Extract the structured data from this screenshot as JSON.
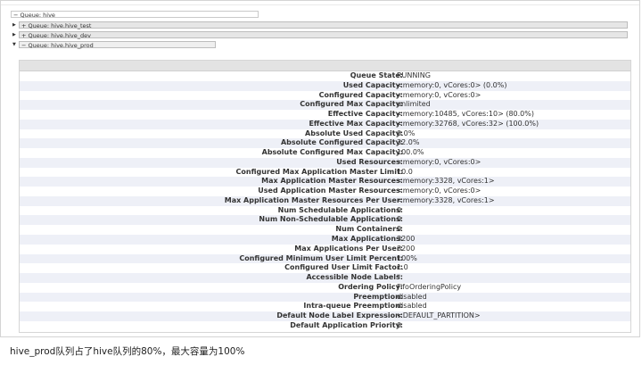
{
  "queues": {
    "root": "Queue: hive",
    "children": [
      {
        "label": "Queue: hive.hive_test"
      },
      {
        "label": "Queue: hive.hive_dev"
      },
      {
        "label": "Queue: hive.hive_prod"
      }
    ]
  },
  "details": [
    {
      "key": "Queue State:",
      "value": "RUNNING"
    },
    {
      "key": "Used Capacity:",
      "value": "<memory:0, vCores:0> (0.0%)"
    },
    {
      "key": "Configured Capacity:",
      "value": "<memory:0, vCores:0>"
    },
    {
      "key": "Configured Max Capacity:",
      "value": "unlimited"
    },
    {
      "key": "Effective Capacity:",
      "value": "<memory:10485, vCores:10> (80.0%)"
    },
    {
      "key": "Effective Max Capacity:",
      "value": "<memory:32768, vCores:32> (100.0%)"
    },
    {
      "key": "Absolute Used Capacity:",
      "value": "0.0%"
    },
    {
      "key": "Absolute Configured Capacity:",
      "value": "32.0%"
    },
    {
      "key": "Absolute Configured Max Capacity:",
      "value": "100.0%"
    },
    {
      "key": "Used Resources:",
      "value": "<memory:0, vCores:0>"
    },
    {
      "key": "Configured Max Application Master Limit:",
      "value": "10.0"
    },
    {
      "key": "Max Application Master Resources:",
      "value": "<memory:3328, vCores:1>"
    },
    {
      "key": "Used Application Master Resources:",
      "value": "<memory:0, vCores:0>"
    },
    {
      "key": "Max Application Master Resources Per User:",
      "value": "<memory:3328, vCores:1>"
    },
    {
      "key": "Num Schedulable Applications:",
      "value": "0"
    },
    {
      "key": "Num Non-Schedulable Applications:",
      "value": "0"
    },
    {
      "key": "Num Containers:",
      "value": "0"
    },
    {
      "key": "Max Applications:",
      "value": "3200"
    },
    {
      "key": "Max Applications Per User:",
      "value": "3200"
    },
    {
      "key": "Configured Minimum User Limit Percent:",
      "value": "100%"
    },
    {
      "key": "Configured User Limit Factor:",
      "value": "1.0"
    },
    {
      "key": "Accessible Node Labels:",
      "value": "*"
    },
    {
      "key": "Ordering Policy:",
      "value": "FifoOrderingPolicy"
    },
    {
      "key": "Preemption:",
      "value": "disabled"
    },
    {
      "key": "Intra-queue Preemption:",
      "value": "disabled"
    },
    {
      "key": "Default Node Label Expression:",
      "value": "<DEFAULT_PARTITION>"
    },
    {
      "key": "Default Application Priority:",
      "value": "0"
    }
  ],
  "caption": "hive_prod队列占了hive队列的80%，最大容量为100%"
}
